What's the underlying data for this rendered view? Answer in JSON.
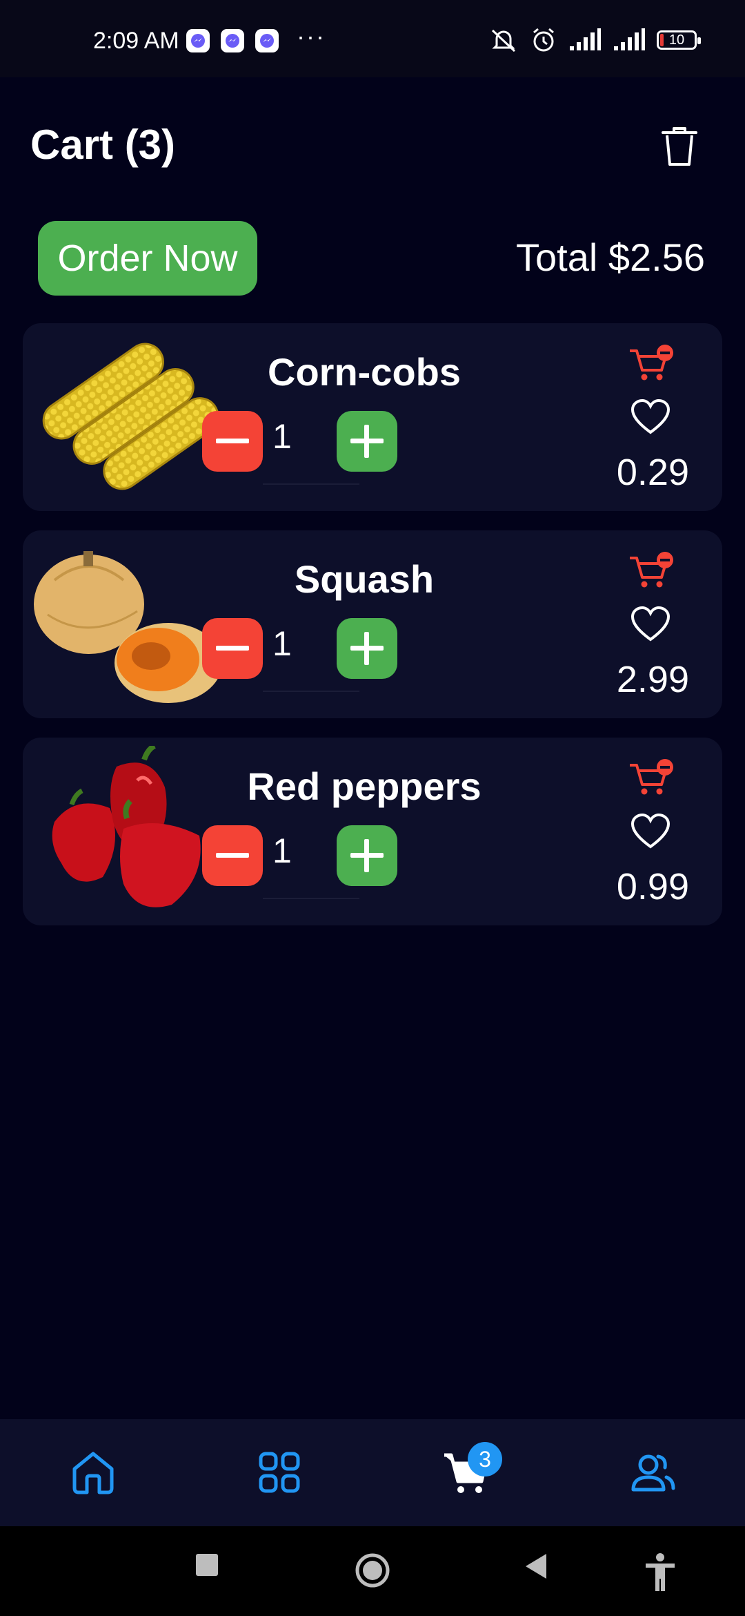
{
  "status_bar": {
    "time": "2:09 AM",
    "dots": "···",
    "battery": "10",
    "icons": [
      "messenger-icon",
      "messenger-icon",
      "messenger-icon",
      "mute-icon",
      "alarm-icon",
      "signal-icon",
      "signal-icon",
      "battery-icon"
    ]
  },
  "header": {
    "title": "Cart (3)"
  },
  "order": {
    "button_label": "Order Now",
    "total": "Total $2.56"
  },
  "cart_items": [
    {
      "name": "Corn-cobs",
      "qty": "1",
      "price": "0.29",
      "image": "corn-image"
    },
    {
      "name": "Squash",
      "qty": "1",
      "price": "2.99",
      "image": "squash-image"
    },
    {
      "name": "Red peppers",
      "qty": "1",
      "price": "0.99",
      "image": "peppers-image"
    }
  ],
  "nav": {
    "items": [
      "home-icon",
      "grid-icon",
      "cart-icon",
      "users-icon"
    ],
    "cart_badge": "3"
  },
  "colors": {
    "background": "#02021a",
    "card": "#0d0f2a",
    "accent_green": "#4caf50",
    "accent_red": "#f44336",
    "accent_blue": "#2196f3"
  }
}
